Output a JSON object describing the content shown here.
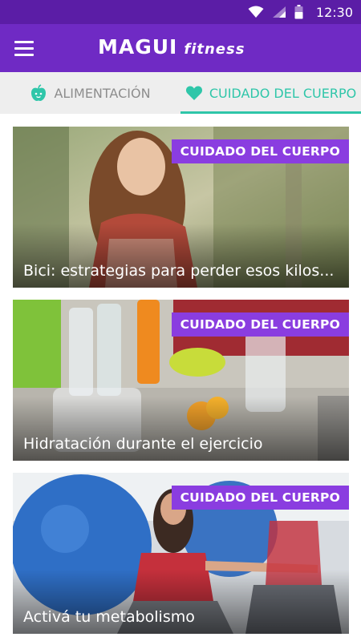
{
  "status_bar": {
    "time": "12:30",
    "icons": [
      "wifi-icon",
      "signal-icon",
      "battery-icon"
    ]
  },
  "app_bar": {
    "menu_icon": "hamburger-menu-icon",
    "logo_main": "MAGUI",
    "logo_sub": "fitness"
  },
  "tabs": [
    {
      "label": "ALIMENTACIÓN",
      "icon": "apple-icon",
      "active": false
    },
    {
      "label": "CUIDADO DEL CUERPO",
      "icon": "heart-icon",
      "active": true
    }
  ],
  "articles": [
    {
      "badge": "CUIDADO DEL CUERPO",
      "title": "Bici: estrategias para perder esos kilos..."
    },
    {
      "badge": "CUIDADO DEL CUERPO",
      "title": "Hidratación durante el ejercicio"
    },
    {
      "badge": "CUIDADO DEL CUERPO",
      "title": "Activá tu metabolismo"
    }
  ],
  "colors": {
    "status_bar": "#5b1da6",
    "app_bar": "#6f2ac4",
    "accent": "#2fc6a9",
    "badge": "#8a3de0"
  }
}
